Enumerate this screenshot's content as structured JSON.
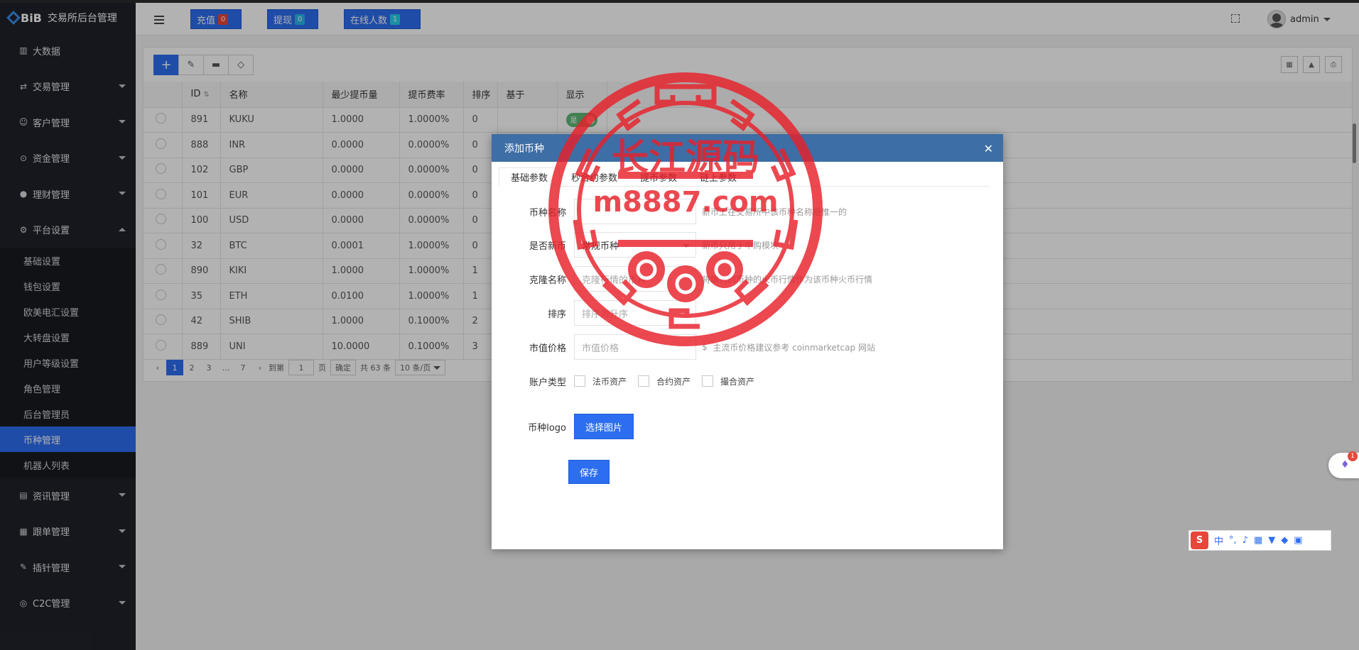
{
  "brand": {
    "logo": "BiB",
    "name": "交易所后台管理"
  },
  "sidebar": {
    "items": [
      {
        "label": "大数据",
        "icon": "chart-icon",
        "caret": ""
      },
      {
        "label": "交易管理",
        "icon": "exchange-icon",
        "caret": "down"
      },
      {
        "label": "客户管理",
        "icon": "users-icon",
        "caret": "down"
      },
      {
        "label": "资金管理",
        "icon": "money-bag-icon",
        "caret": "down"
      },
      {
        "label": "理财管理",
        "icon": "piggy-bank-icon",
        "caret": "down"
      },
      {
        "label": "平台设置",
        "icon": "gear-icon",
        "caret": "up"
      }
    ],
    "sub_items": [
      "基础设置",
      "钱包设置",
      "欧美电汇设置",
      "大转盘设置",
      "用户等级设置",
      "角色管理",
      "后台管理员",
      "币种管理",
      "机器人列表"
    ],
    "active_sub": "币种管理",
    "items_after": [
      {
        "label": "资讯管理",
        "icon": "news-icon"
      },
      {
        "label": "跟单管理",
        "icon": "document-icon"
      },
      {
        "label": "插针管理",
        "icon": "pin-icon"
      },
      {
        "label": "C2C管理",
        "icon": "c2c-icon"
      }
    ]
  },
  "header": {
    "buttons": [
      {
        "label": "充值",
        "badge": "0",
        "badge_color": "#e8463a"
      },
      {
        "label": "提现",
        "badge": "0",
        "badge_color": "#27b6e8"
      },
      {
        "label": "在线人数",
        "badge": "1",
        "badge_color": "#27d0e8"
      }
    ],
    "user": "admin"
  },
  "table": {
    "columns": [
      "ID",
      "名称",
      "最少提币量",
      "提币费率",
      "排序",
      "基于",
      "显示"
    ],
    "rows": [
      {
        "id": "891",
        "name": "KUKU",
        "min": "1.0000",
        "fee": "1.0000%",
        "sort": "0",
        "base": "",
        "show": "是"
      },
      {
        "id": "888",
        "name": "INR",
        "min": "0.0000",
        "fee": "0.0000%",
        "sort": "0",
        "base": "",
        "show": ""
      },
      {
        "id": "102",
        "name": "GBP",
        "min": "0.0000",
        "fee": "0.0000%",
        "sort": "0",
        "base": "",
        "show": ""
      },
      {
        "id": "101",
        "name": "EUR",
        "min": "0.0000",
        "fee": "0.0000%",
        "sort": "0",
        "base": "",
        "show": ""
      },
      {
        "id": "100",
        "name": "USD",
        "min": "0.0000",
        "fee": "0.0000%",
        "sort": "0",
        "base": "",
        "show": ""
      },
      {
        "id": "32",
        "name": "BTC",
        "min": "0.0001",
        "fee": "1.0000%",
        "sort": "0",
        "base": "",
        "show": ""
      },
      {
        "id": "890",
        "name": "KIKI",
        "min": "1.0000",
        "fee": "1.0000%",
        "sort": "1",
        "base": "",
        "show": ""
      },
      {
        "id": "35",
        "name": "ETH",
        "min": "0.0100",
        "fee": "1.0000%",
        "sort": "1",
        "base": "",
        "show": ""
      },
      {
        "id": "42",
        "name": "SHIB",
        "min": "1.0000",
        "fee": "0.1000%",
        "sort": "2",
        "base": "",
        "show": ""
      },
      {
        "id": "889",
        "name": "UNI",
        "min": "10.0000",
        "fee": "0.1000%",
        "sort": "3",
        "base": "",
        "show": ""
      }
    ]
  },
  "pager": {
    "pages": [
      "1",
      "2",
      "3",
      "…",
      "7"
    ],
    "current": "1",
    "goto_label": "到第",
    "goto_value": "1",
    "page_unit": "页",
    "confirm": "确定",
    "total": "共 63 条",
    "page_size": "10 条/页"
  },
  "modal": {
    "title": "添加币种",
    "tabs": [
      "基础参数",
      "秒合约参数",
      "提币参数",
      "链上参数"
    ],
    "fields": {
      "name_label": "币种名称",
      "name_hint": "新币上在交易所中该币种名称是惟一的",
      "isnew_label": "是否新币",
      "isnew_value": "常规币种",
      "isnew_hint": "新币只用于申购模块",
      "clone_label": "克隆名称",
      "clone_placeholder": "克隆行情的币种",
      "clone_hint": "将填入的币种的火币行情作为该币种火币行情",
      "sort_label": "排序",
      "sort_placeholder": "排序为升序",
      "price_label": "市值价格",
      "price_placeholder": "市值价格",
      "price_hint_sym": "$",
      "price_hint": "主流币价格建议参考 coinmarketcap 网站",
      "account_label": "账户类型",
      "accounts": [
        "法币资产",
        "合约资产",
        "撮合资产"
      ],
      "logo_label": "币种logo",
      "logo_button": "选择图片",
      "save_button": "保存"
    }
  },
  "stamp": {
    "line1": "长江源码",
    "line2": "m8887.com",
    "color": "#e8202a"
  },
  "ime": {
    "logo": "S",
    "mode": "中"
  }
}
